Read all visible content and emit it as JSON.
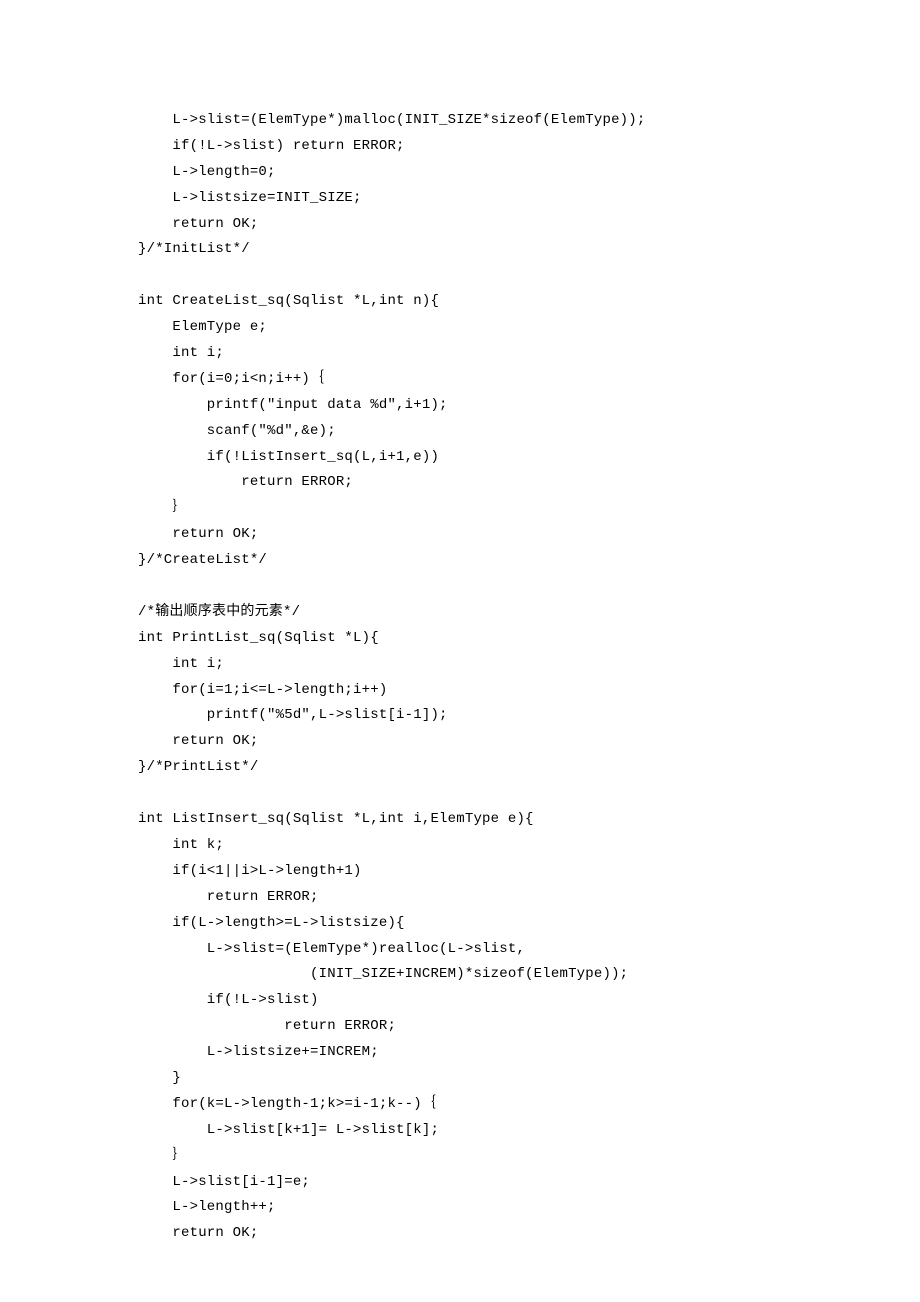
{
  "code": {
    "lines": [
      "    L->slist=(ElemType*)malloc(INIT_SIZE*sizeof(ElemType));",
      "    if(!L->slist) return ERROR;",
      "    L->length=0;",
      "    L->listsize=INIT_SIZE;",
      "    return OK;",
      "}/*InitList*/",
      "",
      "int CreateList_sq(Sqlist *L,int n){",
      "    ElemType e;",
      "    int i;",
      "    for(i=0;i<n;i++)｛",
      "        printf(\"input data %d\",i+1);",
      "        scanf(\"%d\",&e);",
      "        if(!ListInsert_sq(L,i+1,e))",
      "            return ERROR;",
      "    ｝",
      "    return OK;",
      "}/*CreateList*/",
      "",
      "/*输出顺序表中的元素*/",
      "int PrintList_sq(Sqlist *L){",
      "    int i;",
      "    for(i=1;i<=L->length;i++)",
      "        printf(\"%5d\",L->slist[i-1]);",
      "    return OK;",
      "}/*PrintList*/",
      "",
      "int ListInsert_sq(Sqlist *L,int i,ElemType e){",
      "    int k;",
      "    if(i<1||i>L->length+1)",
      "        return ERROR;",
      "    if(L->length>=L->listsize){",
      "        L->slist=(ElemType*)realloc(L->slist,",
      "                    (INIT_SIZE+INCREM)*sizeof(ElemType));",
      "        if(!L->slist)",
      "                 return ERROR;",
      "        L->listsize+=INCREM;",
      "    }",
      "    for(k=L->length-1;k>=i-1;k--)｛",
      "        L->slist[k+1]= L->slist[k];",
      "    ｝",
      "    L->slist[i-1]=e;",
      "    L->length++;",
      "    return OK;"
    ]
  }
}
